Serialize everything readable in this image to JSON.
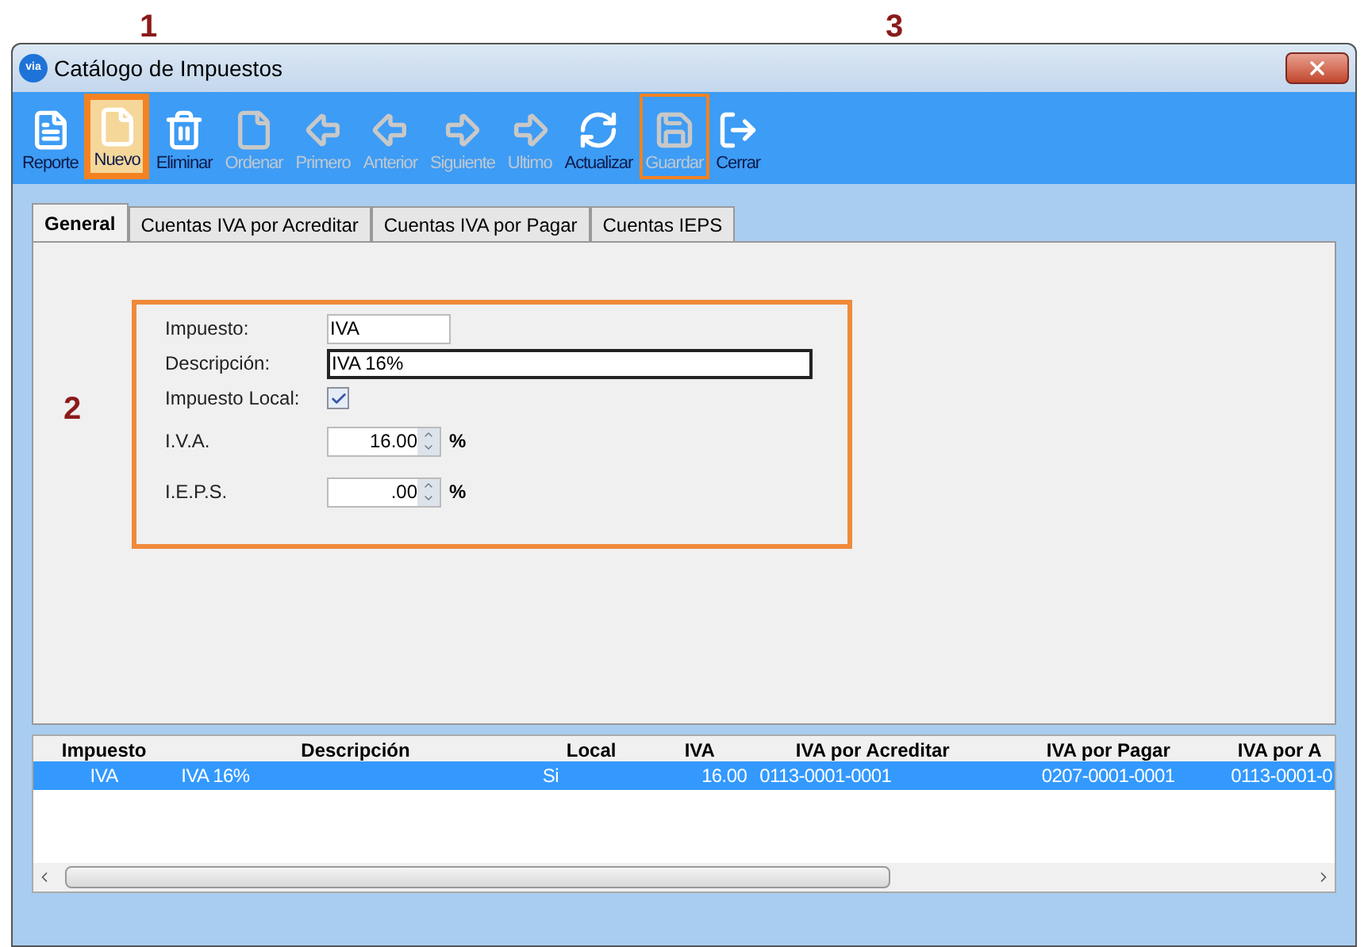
{
  "callouts": [
    {
      "label": "1"
    },
    {
      "label": "2"
    },
    {
      "label": "3"
    }
  ],
  "window": {
    "title": "Catálogo de Impuestos",
    "logo": "via"
  },
  "toolbar": [
    {
      "label": "Reporte",
      "disabled": false,
      "highlighted": false
    },
    {
      "label": "Nuevo",
      "disabled": false,
      "highlighted": true
    },
    {
      "label": "Eliminar",
      "disabled": false,
      "highlighted": false
    },
    {
      "label": "Ordenar",
      "disabled": true,
      "highlighted": false
    },
    {
      "label": "Primero",
      "disabled": true,
      "highlighted": false
    },
    {
      "label": "Anterior",
      "disabled": true,
      "highlighted": false
    },
    {
      "label": "Siguiente",
      "disabled": true,
      "highlighted": false
    },
    {
      "label": "Ultimo",
      "disabled": true,
      "highlighted": false
    },
    {
      "label": "Actualizar",
      "disabled": false,
      "highlighted": false
    },
    {
      "label": "Guardar",
      "disabled": true,
      "highlighted": true
    },
    {
      "label": "Cerrar",
      "disabled": false,
      "highlighted": false
    }
  ],
  "tabs": [
    {
      "label": "General",
      "selected": true
    },
    {
      "label": "Cuentas IVA por Acreditar",
      "selected": false
    },
    {
      "label": "Cuentas IVA por Pagar",
      "selected": false
    },
    {
      "label": "Cuentas IEPS",
      "selected": false
    }
  ],
  "form": {
    "highlighted": true,
    "fields": [
      {
        "kind": "text",
        "label": "Impuesto:",
        "value": "IVA",
        "focused": false
      },
      {
        "kind": "text",
        "label": "Descripción:",
        "value": "IVA 16%",
        "focused": true
      },
      {
        "kind": "checkbox",
        "label": "Impuesto Local:",
        "checked": true
      },
      {
        "kind": "spinner",
        "label": "I.V.A.",
        "value": "16.00",
        "unit": "%"
      },
      {
        "kind": "spinner",
        "label": "I.E.P.S.",
        "value": ".00",
        "unit": "%"
      }
    ]
  },
  "table": {
    "columns": [
      "Impuesto",
      "Descripción",
      "Local",
      "IVA",
      "IVA por Acreditar",
      "IVA por Pagar",
      "IVA por A"
    ],
    "rows": [
      {
        "selected": true,
        "cells": [
          "IVA",
          "IVA 16%",
          "Si",
          "16.00",
          "0113-0001-0001",
          "0207-0001-0001",
          "0113-0001-0"
        ]
      }
    ]
  }
}
